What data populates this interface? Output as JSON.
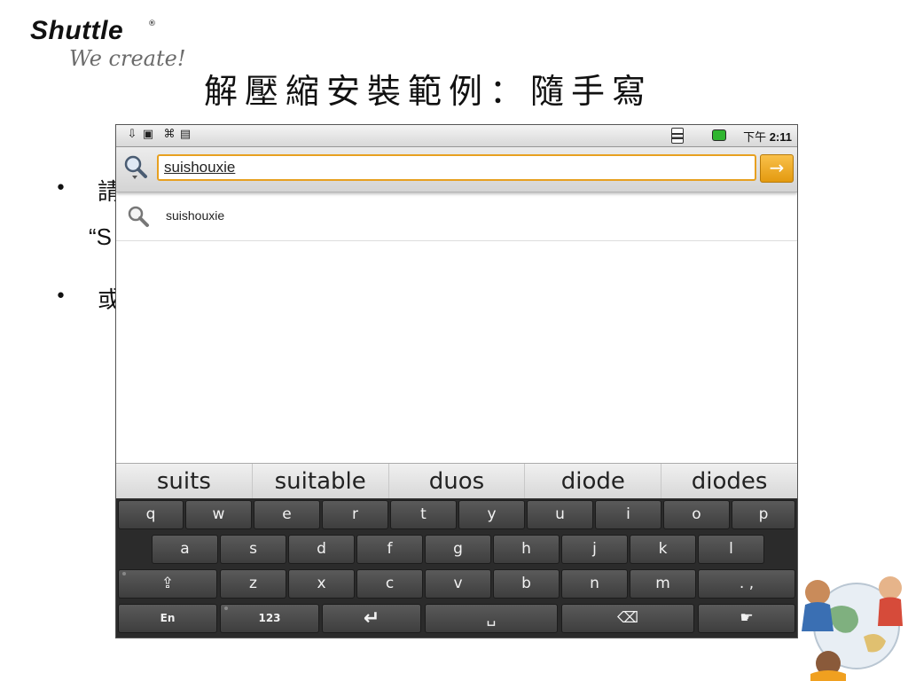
{
  "slide": {
    "logo_brand": "Shuttle",
    "logo_reg": "®",
    "logo_slogan": "We create!",
    "title": "解壓縮安裝範例：隨手寫",
    "bullets": [
      {
        "marker": "•",
        "text": "請"
      },
      {
        "marker": "",
        "text": "“S"
      },
      {
        "marker": "•",
        "text": "或"
      }
    ]
  },
  "statusbar": {
    "time_prefix": "下午 ",
    "time": "2:11",
    "icons": [
      "download-icon",
      "notification-icon",
      "usb-icon",
      "android-debug-icon",
      "signal-icon",
      "battery-icon"
    ]
  },
  "search": {
    "query": "suishouxie",
    "go_label": "→"
  },
  "suggestions": [
    "suishouxie"
  ],
  "candidates": [
    "suits",
    "suitable",
    "duos",
    "diode",
    "diodes"
  ],
  "keyboard": {
    "row1": [
      "q",
      "w",
      "e",
      "r",
      "t",
      "y",
      "u",
      "i",
      "o",
      "p"
    ],
    "row2": [
      "a",
      "s",
      "d",
      "f",
      "g",
      "h",
      "j",
      "k",
      "l"
    ],
    "row3": [
      "⇪",
      "z",
      "x",
      "c",
      "v",
      "b",
      "n",
      "m",
      ". ,"
    ],
    "row4": [
      "En",
      "123",
      "↵",
      "␣",
      "⌫",
      "☛"
    ]
  },
  "colors": {
    "accent": "#e7a020",
    "battery": "#2fb52f",
    "keyboard_bg": "#2b2b2b"
  }
}
